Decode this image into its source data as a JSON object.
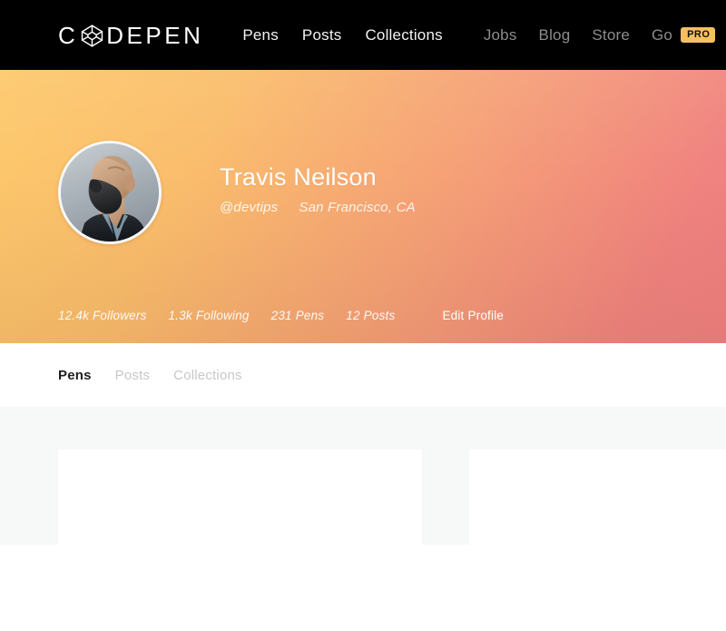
{
  "navbar": {
    "logo": {
      "name": "CodePen",
      "text_before": "C",
      "mark": "codepen-logo-mark",
      "text_after": "DEPEN"
    },
    "primary_links": [
      {
        "label": "Pens",
        "icon": "pens-link"
      },
      {
        "label": "Posts",
        "icon": "posts-link"
      },
      {
        "label": "Collections",
        "icon": "collections-link"
      }
    ],
    "secondary_links": [
      {
        "label": "Jobs"
      },
      {
        "label": "Blog"
      },
      {
        "label": "Store"
      }
    ],
    "go_pro": {
      "label": "Go",
      "badge": "PRO"
    },
    "colors": {
      "background": "#000000",
      "primary_link": "#f2f2f2",
      "secondary_link": "#8c8c8c",
      "pro_badge_bg": "#f6bf62",
      "pro_badge_text": "#111111"
    }
  },
  "hero": {
    "avatar": {
      "alt": "Travis Neilson profile photo",
      "icon": "avatar-photo"
    },
    "display_name": "Travis Neilson",
    "username": "@devtips",
    "location": "San Francisco, CA",
    "stats": [
      {
        "label": "12.4k Followers",
        "name": "followers"
      },
      {
        "label": "1.3k Following",
        "name": "following"
      },
      {
        "label": "231 Pens",
        "name": "pens"
      },
      {
        "label": "12 Posts",
        "name": "posts"
      }
    ],
    "edit_profile_label": "Edit Profile",
    "colors": {
      "gradient_start": "#fdc96c",
      "gradient_end": "#f0827f",
      "text": "#ffffff"
    }
  },
  "tabs": [
    {
      "label": "Pens",
      "active": true
    },
    {
      "label": "Posts",
      "active": false
    },
    {
      "label": "Collections",
      "active": false
    }
  ],
  "content": {
    "background": "#f7f8f8",
    "cards": [
      {
        "name": "pen-card-1"
      },
      {
        "name": "pen-card-2"
      }
    ]
  }
}
